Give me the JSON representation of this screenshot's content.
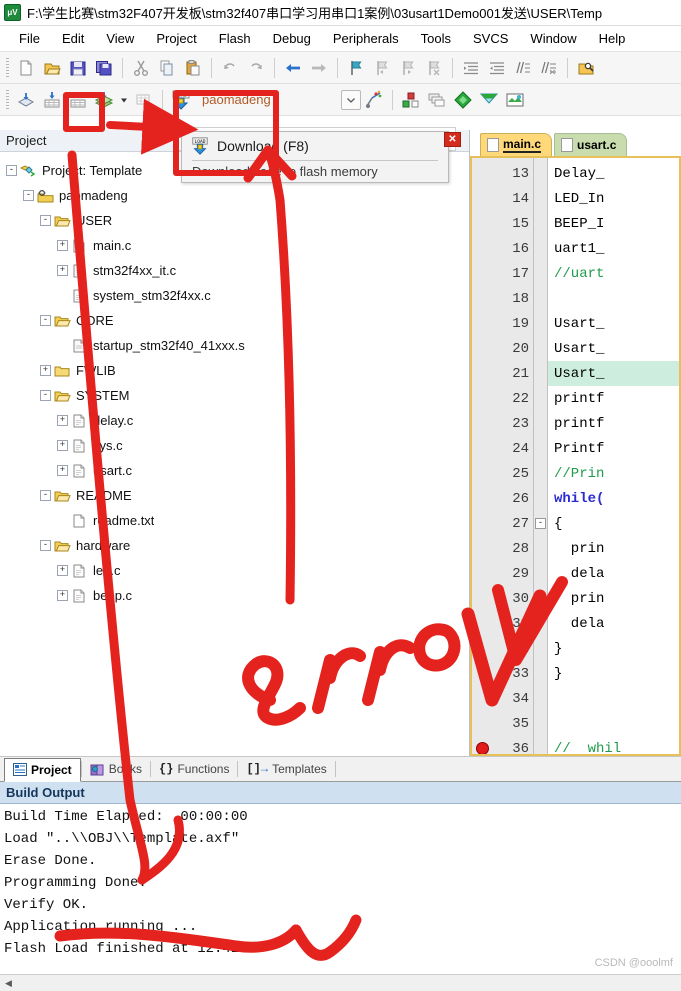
{
  "window": {
    "title": "F:\\学生比赛\\stm32F407开发板\\stm32f407串口学习用串口1案例\\03usart1Demo001发送\\USER\\Temp",
    "app_icon": "keil-uvision-icon"
  },
  "menubar": {
    "items": [
      "File",
      "Edit",
      "View",
      "Project",
      "Flash",
      "Debug",
      "Peripherals",
      "Tools",
      "SVCS",
      "Window",
      "Help"
    ]
  },
  "toolbar_top": {
    "buttons": [
      {
        "name": "new-file-icon",
        "title": "New"
      },
      {
        "name": "open-file-icon",
        "title": "Open"
      },
      {
        "name": "save-icon",
        "title": "Save"
      },
      {
        "name": "save-all-icon",
        "title": "Save All"
      },
      {
        "name": "cut-icon",
        "title": "Cut"
      },
      {
        "name": "copy-icon",
        "title": "Copy"
      },
      {
        "name": "paste-icon",
        "title": "Paste"
      },
      {
        "name": "undo-icon",
        "title": "Undo"
      },
      {
        "name": "redo-icon",
        "title": "Redo"
      },
      {
        "name": "navigate-back-icon",
        "title": "Back"
      },
      {
        "name": "navigate-forward-icon",
        "title": "Forward"
      },
      {
        "name": "bookmark-toggle-icon",
        "title": "Insert/Remove Bookmark"
      },
      {
        "name": "bookmark-prev-icon",
        "title": "Previous Bookmark"
      },
      {
        "name": "bookmark-next-icon",
        "title": "Next Bookmark"
      },
      {
        "name": "bookmark-clear-icon",
        "title": "Clear All Bookmarks"
      },
      {
        "name": "indent-right-icon",
        "title": "Indent"
      },
      {
        "name": "indent-left-icon",
        "title": "Outdent"
      },
      {
        "name": "comment-icon",
        "title": "Comment"
      },
      {
        "name": "uncomment-icon",
        "title": "Uncomment"
      },
      {
        "name": "find-in-files-icon",
        "title": "Find in Files"
      }
    ]
  },
  "toolbar_build": {
    "buttons": [
      {
        "name": "translate-icon",
        "title": "Translate"
      },
      {
        "name": "build-icon",
        "title": "Build"
      },
      {
        "name": "rebuild-icon",
        "title": "Rebuild"
      },
      {
        "name": "batch-build-icon",
        "title": "Batch Build"
      },
      {
        "name": "stop-build-icon",
        "title": "Stop Build"
      },
      {
        "name": "download-icon",
        "title": "Download"
      }
    ],
    "project_name": "paomadeng",
    "right_buttons": [
      {
        "name": "target-options-icon",
        "title": "Options for Target"
      },
      {
        "name": "manage-components-icon",
        "title": "Manage Project Items"
      },
      {
        "name": "pack-installer-icon",
        "title": "Pack Installer"
      },
      {
        "name": "manage-rte-icon",
        "title": "Manage Run-Time Environment"
      },
      {
        "name": "configure-icon",
        "title": "Configure"
      }
    ]
  },
  "tooltip": {
    "title": "Download (F8)",
    "description": "Download code to flash memory",
    "icon": "download-icon",
    "close_label": "✕"
  },
  "project_pane": {
    "header": "Project",
    "tree": [
      {
        "label": "Project: Template",
        "depth": 0,
        "toggle": "-",
        "icon": "project-icon"
      },
      {
        "label": "paomadeng",
        "depth": 1,
        "toggle": "-",
        "icon": "target-icon"
      },
      {
        "label": "USER",
        "depth": 2,
        "toggle": "-",
        "icon": "folder-open-icon"
      },
      {
        "label": "main.c",
        "depth": 3,
        "toggle": "+",
        "icon": "c-file-icon"
      },
      {
        "label": "stm32f4xx_it.c",
        "depth": 3,
        "toggle": "+",
        "icon": "c-file-icon"
      },
      {
        "label": "system_stm32f4xx.c",
        "depth": 3,
        "toggle": "",
        "icon": "c-file-icon"
      },
      {
        "label": "CORE",
        "depth": 2,
        "toggle": "-",
        "icon": "folder-open-icon"
      },
      {
        "label": "startup_stm32f40_41xxx.s",
        "depth": 3,
        "toggle": "",
        "icon": "asm-file-icon"
      },
      {
        "label": "FWLIB",
        "depth": 2,
        "toggle": "+",
        "icon": "folder-closed-icon"
      },
      {
        "label": "SYSTEM",
        "depth": 2,
        "toggle": "-",
        "icon": "folder-open-icon"
      },
      {
        "label": "delay.c",
        "depth": 3,
        "toggle": "+",
        "icon": "c-file-icon"
      },
      {
        "label": "sys.c",
        "depth": 3,
        "toggle": "+",
        "icon": "c-file-icon"
      },
      {
        "label": "usart.c",
        "depth": 3,
        "toggle": "+",
        "icon": "c-file-icon"
      },
      {
        "label": "README",
        "depth": 2,
        "toggle": "-",
        "icon": "folder-open-icon"
      },
      {
        "label": "readme.txt",
        "depth": 3,
        "toggle": "",
        "icon": "txt-file-icon"
      },
      {
        "label": "hardware",
        "depth": 2,
        "toggle": "-",
        "icon": "folder-open-icon"
      },
      {
        "label": "led.c",
        "depth": 3,
        "toggle": "+",
        "icon": "c-file-icon"
      },
      {
        "label": "beep.c",
        "depth": 3,
        "toggle": "+",
        "icon": "c-file-icon"
      }
    ]
  },
  "editor": {
    "tabs": [
      {
        "label": "main.c",
        "active": true
      },
      {
        "label": "usart.c",
        "active": false
      }
    ],
    "first_line": 13,
    "lines": [
      {
        "n": 13,
        "text": "Delay_",
        "kind": "plain",
        "highlight": false,
        "fold": "",
        "breakpoint": false
      },
      {
        "n": 14,
        "text": "LED_In",
        "kind": "plain",
        "highlight": false,
        "fold": "",
        "breakpoint": false
      },
      {
        "n": 15,
        "text": "BEEP_I",
        "kind": "plain",
        "highlight": false,
        "fold": "",
        "breakpoint": false
      },
      {
        "n": 16,
        "text": "uart1_",
        "kind": "plain",
        "highlight": false,
        "fold": "",
        "breakpoint": false
      },
      {
        "n": 17,
        "text": "//uart",
        "kind": "comment",
        "highlight": false,
        "fold": "",
        "breakpoint": false
      },
      {
        "n": 18,
        "text": "",
        "kind": "plain",
        "highlight": false,
        "fold": "",
        "breakpoint": false
      },
      {
        "n": 19,
        "text": "Usart_",
        "kind": "plain",
        "highlight": false,
        "fold": "",
        "breakpoint": false
      },
      {
        "n": 20,
        "text": "Usart_",
        "kind": "plain",
        "highlight": false,
        "fold": "",
        "breakpoint": false
      },
      {
        "n": 21,
        "text": "Usart_",
        "kind": "plain",
        "highlight": true,
        "fold": "",
        "breakpoint": false
      },
      {
        "n": 22,
        "text": "printf",
        "kind": "plain",
        "highlight": false,
        "fold": "",
        "breakpoint": false
      },
      {
        "n": 23,
        "text": "printf",
        "kind": "plain",
        "highlight": false,
        "fold": "",
        "breakpoint": false
      },
      {
        "n": 24,
        "text": "Printf",
        "kind": "plain",
        "highlight": false,
        "fold": "",
        "breakpoint": false
      },
      {
        "n": 25,
        "text": "//Prin",
        "kind": "comment",
        "highlight": false,
        "fold": "",
        "breakpoint": false
      },
      {
        "n": 26,
        "text": "while(",
        "kind": "keyword",
        "highlight": false,
        "fold": "",
        "breakpoint": false
      },
      {
        "n": 27,
        "text": "{",
        "kind": "plain",
        "highlight": false,
        "fold": "-",
        "breakpoint": false
      },
      {
        "n": 28,
        "text": "  prin",
        "kind": "plain",
        "highlight": false,
        "fold": "",
        "breakpoint": false
      },
      {
        "n": 29,
        "text": "  dela",
        "kind": "plain",
        "highlight": false,
        "fold": "",
        "breakpoint": false
      },
      {
        "n": 30,
        "text": "  prin",
        "kind": "plain",
        "highlight": false,
        "fold": "",
        "breakpoint": false
      },
      {
        "n": 31,
        "text": "  dela",
        "kind": "plain",
        "highlight": false,
        "fold": "",
        "breakpoint": false
      },
      {
        "n": 32,
        "text": "}",
        "kind": "plain",
        "highlight": false,
        "fold": "",
        "breakpoint": false
      },
      {
        "n": 33,
        "text": "}",
        "kind": "plain",
        "highlight": false,
        "fold": "",
        "breakpoint": false
      },
      {
        "n": 34,
        "text": "",
        "kind": "plain",
        "highlight": false,
        "fold": "",
        "breakpoint": false
      },
      {
        "n": 35,
        "text": "",
        "kind": "plain",
        "highlight": false,
        "fold": "",
        "breakpoint": false
      },
      {
        "n": 36,
        "text": "//  whil",
        "kind": "comment",
        "highlight": false,
        "fold": "",
        "breakpoint": true
      }
    ]
  },
  "bottom_tabs": [
    {
      "label": "Project",
      "icon": "project-tab-icon",
      "active": true
    },
    {
      "label": "Books",
      "icon": "books-icon",
      "active": false
    },
    {
      "label": "Functions",
      "icon": "functions-icon",
      "active": false
    },
    {
      "label": "Templates",
      "icon": "templates-icon",
      "active": false
    }
  ],
  "build_output": {
    "header": "Build Output",
    "lines": [
      "Build Time Elapsed:  00:00:00",
      "Load \"..\\\\OBJ\\\\Template.axf\"",
      "Erase Done.",
      "Programming Done.",
      "Verify OK.",
      "Application running ...",
      "Flash Load finished at 12:42:07"
    ]
  },
  "watermark": "CSDN @ooolmf",
  "annotations": {
    "color": "#e5231e",
    "handwritten_text": "error",
    "marks": [
      {
        "name": "rebuild-button-highlight-box",
        "type": "rect"
      },
      {
        "name": "download-button-highlight-box",
        "type": "rect"
      },
      {
        "name": "arrow-to-download-button",
        "type": "arrow"
      },
      {
        "name": "arrow-tree-to-build-output",
        "type": "arrow"
      },
      {
        "name": "arrow-up-to-download",
        "type": "arrow"
      },
      {
        "name": "error-handwriting",
        "type": "text"
      },
      {
        "name": "check-mark-editor",
        "type": "check"
      },
      {
        "name": "underline-flash-load",
        "type": "stroke"
      }
    ]
  }
}
